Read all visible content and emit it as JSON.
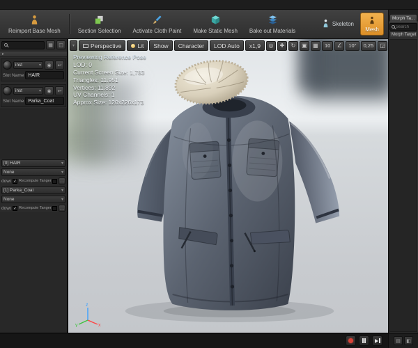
{
  "top_toolbar": {
    "buttons": [
      {
        "label": "Reimport Base Mesh",
        "icon": "reimport-figure-icon"
      },
      {
        "label": "Section Selection",
        "icon": "section-selection-icon"
      },
      {
        "label": "Activate Cloth Paint",
        "icon": "cloth-paint-brush-icon"
      },
      {
        "label": "Make Static Mesh",
        "icon": "static-mesh-cube-icon"
      },
      {
        "label": "Bake out Materials",
        "icon": "bake-materials-layers-icon"
      }
    ],
    "modes": [
      {
        "label": "Skeleton",
        "icon": "skeleton-figure-icon",
        "active": false
      },
      {
        "label": "Mesh",
        "icon": "mesh-figure-icon",
        "active": true,
        "highlight_color": "#e8a33d"
      }
    ]
  },
  "asset_details": {
    "material_elements": [
      {
        "material_combo": "inst",
        "slot_name_label": "Slot Name",
        "slot_name": "HAIR"
      },
      {
        "material_combo": "inst",
        "slot_name_label": "Slot Name",
        "slot_name": "Parka_Coat"
      }
    ],
    "lod_sections": [
      {
        "material": "[0] HAIR",
        "clothing": "None",
        "shadows_label": "dows",
        "recompute_label": "Recompute Tangent"
      },
      {
        "material": "[1] Parka_Coat",
        "clothing": "None",
        "shadows_label": "dows",
        "recompute_label": "Recompute Tangent"
      }
    ]
  },
  "viewport": {
    "toolbar": {
      "perspective": "Perspective",
      "lit": "Lit",
      "show": "Show",
      "character": "Character",
      "lod": "LOD Auto",
      "screen_size": "x1,9"
    },
    "snap_values": {
      "grid": "10",
      "angle": "10°",
      "scale": "0,25"
    },
    "stats": {
      "title": "Previewing Reference Pose",
      "lines": [
        "LOD: 0",
        "Current Screen Size: 1,783",
        "Triangles: 11.951",
        "Vertices: 11.892",
        "UV Channels: 1",
        "Approx Size: 120x226x173"
      ]
    },
    "axis_labels": {
      "x": "x",
      "y": "y",
      "z": "z"
    }
  },
  "morph_panel": {
    "tab": "Morph Ta...",
    "search_placeholder": "Search",
    "header": "Morph Target"
  }
}
